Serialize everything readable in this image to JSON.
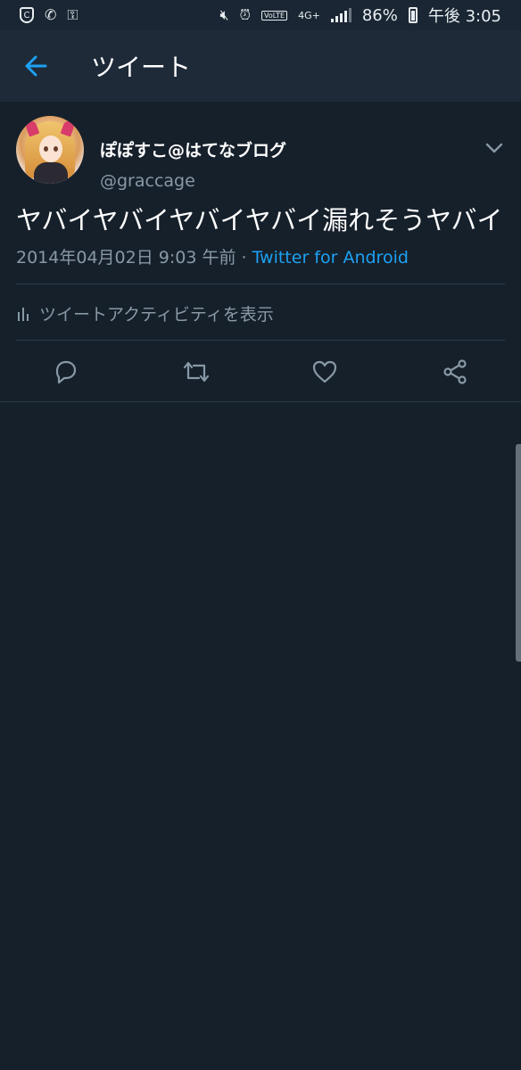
{
  "status_bar": {
    "battery": "86%",
    "time": "午後 3:05",
    "network": "4G+",
    "volte": "VoLTE"
  },
  "app_bar": {
    "title": "ツイート"
  },
  "tweet": {
    "display_name": "ぽぽすこ@はてなブログ",
    "handle": "@graccage",
    "text": "ヤバイヤバイヤバイヤバイ漏れそうヤバイ",
    "timestamp": "2014年04月02日 9:03 午前 · ",
    "source": "Twitter for Android",
    "activity_label": "ツイートアクティビティを表示"
  },
  "colors": {
    "background": "#16202b",
    "app_bar": "#1e2a38",
    "accent": "#1da1f2",
    "secondary_text": "#8899a6"
  },
  "icons": {
    "back": "arrow-left-icon",
    "menu": "chevron-down-icon",
    "activity": "bar-chart-icon",
    "reply": "reply-icon",
    "retweet": "retweet-icon",
    "like": "heart-icon",
    "share": "share-icon"
  }
}
